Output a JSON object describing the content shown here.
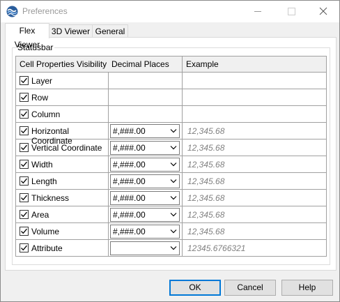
{
  "window": {
    "title": "Preferences"
  },
  "tabs": [
    {
      "label": "Flex Viewer",
      "active": true
    },
    {
      "label": "3D Viewer",
      "active": false
    },
    {
      "label": "General",
      "active": false
    }
  ],
  "group": {
    "label": "Statusbar"
  },
  "table": {
    "headers": [
      "Cell Properties Visibility",
      "Decimal Places",
      "Example"
    ],
    "rows": [
      {
        "label": "Layer",
        "checked": true,
        "format": null,
        "example": ""
      },
      {
        "label": "Row",
        "checked": true,
        "format": null,
        "example": ""
      },
      {
        "label": "Column",
        "checked": true,
        "format": null,
        "example": ""
      },
      {
        "label": "Horizontal Coordinate",
        "checked": true,
        "format": "#,###.00",
        "example": "12,345.68"
      },
      {
        "label": "Vertical Coordinate",
        "checked": true,
        "format": "#,###.00",
        "example": "12,345.68"
      },
      {
        "label": "Width",
        "checked": true,
        "format": "#,###.00",
        "example": "12,345.68"
      },
      {
        "label": "Length",
        "checked": true,
        "format": "#,###.00",
        "example": "12,345.68"
      },
      {
        "label": "Thickness",
        "checked": true,
        "format": "#,###.00",
        "example": "12,345.68"
      },
      {
        "label": "Area",
        "checked": true,
        "format": "#,###.00",
        "example": "12,345.68"
      },
      {
        "label": "Volume",
        "checked": true,
        "format": "#,###.00",
        "example": "12,345.68"
      },
      {
        "label": "Attribute",
        "checked": true,
        "format": "",
        "example": "12345.6766321"
      }
    ]
  },
  "buttons": {
    "ok": "OK",
    "cancel": "Cancel",
    "help": "Help"
  },
  "icons": {
    "app": "app-logo-icon",
    "minimize": "minimize-icon",
    "maximize": "maximize-icon",
    "close": "close-icon",
    "checkbox": "checkmark-icon",
    "dropdown": "chevron-down-icon"
  },
  "colors": {
    "accent": "#0078d7",
    "grid_line": "#a0a0a0",
    "example_text": "#808080"
  }
}
